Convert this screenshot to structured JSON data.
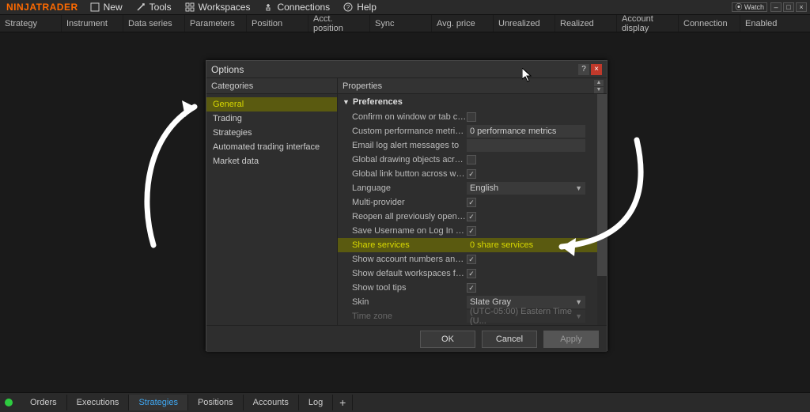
{
  "brand": "NINJATRADER",
  "menu": {
    "new": "New",
    "tools": "Tools",
    "workspaces": "Workspaces",
    "connections": "Connections",
    "help": "Help"
  },
  "titlebar": {
    "watch": "Watch"
  },
  "columns": {
    "strategy": "Strategy",
    "instrument": "Instrument",
    "data_series": "Data series",
    "parameters": "Parameters",
    "position": "Position",
    "acct_position": "Acct. position",
    "sync": "Sync",
    "avg_price": "Avg. price",
    "unrealized": "Unrealized",
    "realized": "Realized",
    "account_display": "Account display",
    "connection": "Connection",
    "enabled": "Enabled"
  },
  "dialog": {
    "title": "Options",
    "categories_header": "Categories",
    "properties_header": "Properties",
    "categories": {
      "general": "General",
      "trading": "Trading",
      "strategies": "Strategies",
      "ati": "Automated trading interface",
      "market_data": "Market data"
    },
    "section": "Preferences",
    "props": {
      "confirm_close": "Confirm on window or tab close",
      "custom_perf": "Custom performance metric(s)",
      "custom_perf_val": "0 performance metrics",
      "email_log": "Email log alert messages to",
      "global_drawing": "Global drawing objects across...",
      "global_link": "Global link button across work...",
      "language": "Language",
      "language_val": "English",
      "multi_provider": "Multi-provider",
      "reopen": "Reopen all previously open wo...",
      "save_user": "Save Username on Log In win...",
      "share_services": "Share services",
      "share_services_val": "0 share services",
      "show_account": "Show account numbers and b...",
      "show_default_ws": "Show default workspaces folder",
      "show_tooltips": "Show tool tips",
      "skin": "Skin",
      "skin_val": "Slate Gray",
      "timezone": "Time zone",
      "timezone_val": "(UTC-05:00) Eastern Time (U..."
    },
    "buttons": {
      "ok": "OK",
      "cancel": "Cancel",
      "apply": "Apply"
    }
  },
  "tabs": {
    "orders": "Orders",
    "executions": "Executions",
    "strategies": "Strategies",
    "positions": "Positions",
    "accounts": "Accounts",
    "log": "Log",
    "plus": "+"
  }
}
